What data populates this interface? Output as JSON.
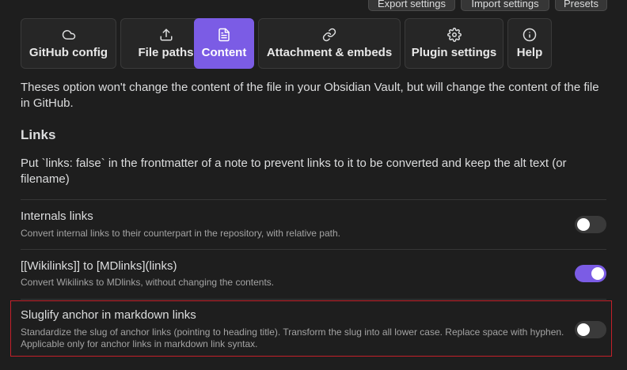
{
  "top_actions": {
    "export": "Export settings",
    "import": "Import settings",
    "presets": "Presets"
  },
  "tabs": [
    {
      "label": "GitHub config",
      "icon": "cloud-icon",
      "active": false
    },
    {
      "label": "File paths",
      "icon": "upload-icon",
      "active": false
    },
    {
      "label": "Content",
      "icon": "file-text-icon",
      "active": true
    },
    {
      "label": "Attachment & embeds",
      "icon": "link-icon",
      "active": false
    },
    {
      "label": "Plugin settings",
      "icon": "gear-icon",
      "active": false
    },
    {
      "label": "Help",
      "icon": "info-icon",
      "active": false
    }
  ],
  "intro": "Theses option won't change the content of the file in your Obsidian Vault, but will change the content of the file in GitHub.",
  "links_section": {
    "title": "Links",
    "description": "Put `links: false` in the frontmatter of a note to prevent links to it to be converted and keep the alt text (or filename)"
  },
  "settings": [
    {
      "name": "Internals links",
      "description": "Convert internal links to their counterpart in the repository, with relative path.",
      "enabled": false
    },
    {
      "name": "[[Wikilinks]] to [MDlinks](links)",
      "description": "Convert Wikilinks to MDlinks, without changing the contents.",
      "enabled": true
    },
    {
      "name": "Sluglify anchor in markdown links",
      "description": "Standardize the slug of anchor links (pointing to heading title). Transform the slug into all lower case. Replace space with hyphen. Applicable only for anchor links in markdown link syntax.",
      "enabled": false,
      "highlighted": true
    }
  ],
  "colors": {
    "accent": "#7b5ce5",
    "highlight_border": "#c4202a",
    "background": "#1e1e1e"
  }
}
